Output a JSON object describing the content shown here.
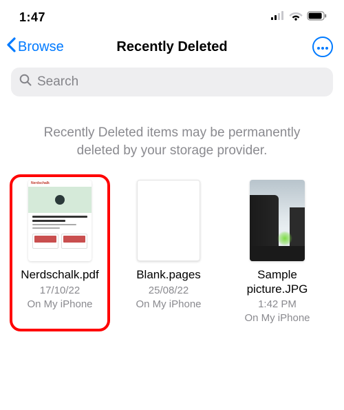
{
  "status": {
    "time": "1:47"
  },
  "nav": {
    "back_label": "Browse",
    "title": "Recently Deleted"
  },
  "search": {
    "placeholder": "Search"
  },
  "info_message": "Recently Deleted items may be permanently deleted by your storage provider.",
  "files": [
    {
      "name": "Nerdschalk.pdf",
      "date": "17/10/22",
      "location": "On My iPhone",
      "highlighted": true,
      "thumb_type": "pdf"
    },
    {
      "name": "Blank.pages",
      "date": "25/08/22",
      "location": "On My iPhone",
      "highlighted": false,
      "thumb_type": "blank"
    },
    {
      "name": "Sample picture.JPG",
      "date": "1:42 PM",
      "location": "On My iPhone",
      "highlighted": false,
      "thumb_type": "photo"
    }
  ]
}
